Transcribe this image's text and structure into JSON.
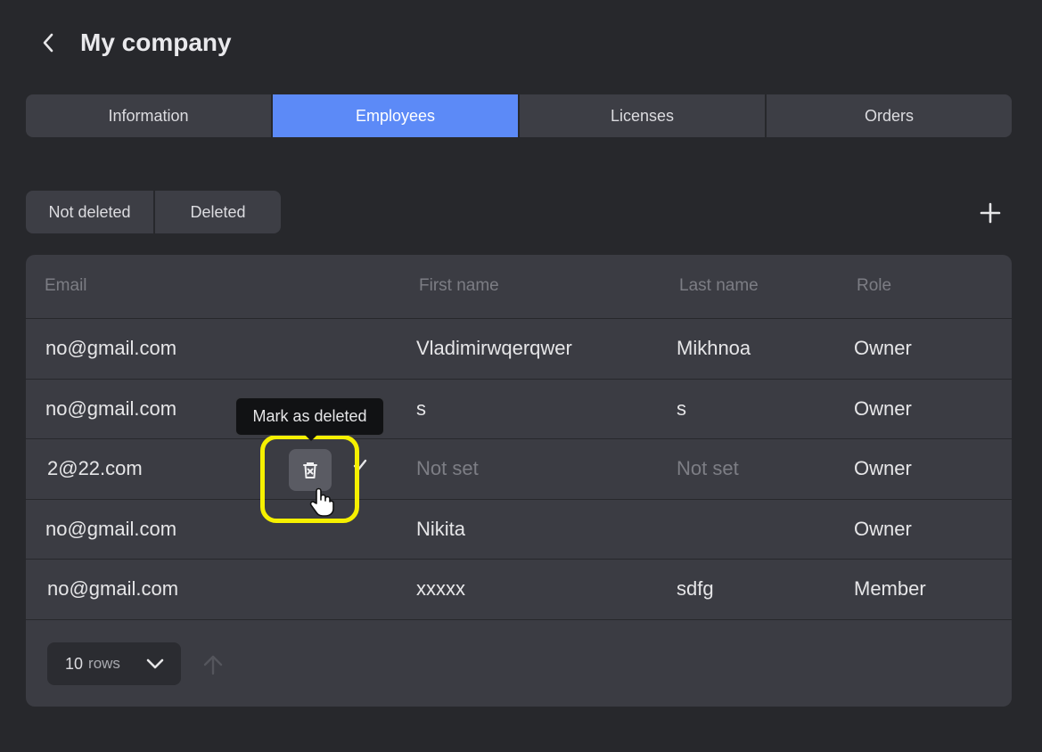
{
  "header": {
    "title": "My company",
    "back_icon": "chevron-left-icon"
  },
  "tabs": [
    {
      "label": "Information",
      "active": false
    },
    {
      "label": "Employees",
      "active": true
    },
    {
      "label": "Licenses",
      "active": false
    },
    {
      "label": "Orders",
      "active": false
    }
  ],
  "filter": {
    "not_deleted_label": "Not deleted",
    "deleted_label": "Deleted"
  },
  "add_icon": "plus-icon",
  "table": {
    "columns": [
      "Email",
      "First name",
      "Last name",
      "Role"
    ],
    "rows": [
      {
        "email": "no@gmail.com",
        "first_name": "Vladimirwqerqwer",
        "last_name": "Mikhnoa",
        "role": "Owner"
      },
      {
        "email": "no@gmail.com",
        "first_name": "s",
        "last_name": "s",
        "role": "Owner"
      },
      {
        "email": "2@22.com",
        "first_name": "Not set",
        "last_name": "Not set",
        "role": "Owner"
      },
      {
        "email": "no@gmail.com",
        "first_name": "Nikita",
        "last_name": "",
        "role": "Owner"
      },
      {
        "email": "no@gmail.com",
        "first_name": "xxxxx",
        "last_name": "sdfg",
        "role": "Member"
      }
    ]
  },
  "footer": {
    "rows_count": "10",
    "rows_word": "rows"
  },
  "tooltip": {
    "text": "Mark as deleted"
  },
  "colors": {
    "background": "#27282c",
    "accent": "#5c8af7",
    "highlight": "#f6f000"
  }
}
